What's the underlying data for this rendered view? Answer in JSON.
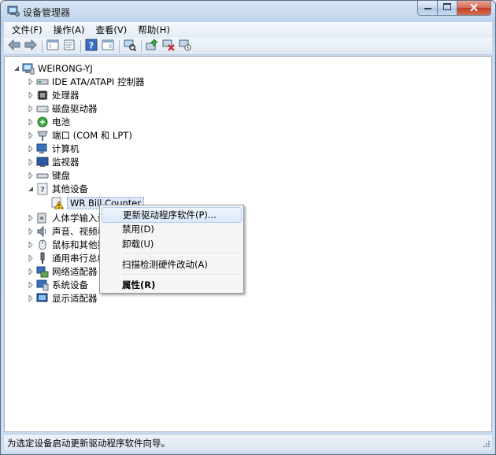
{
  "window": {
    "title": "设备管理器",
    "icons": {
      "app": "device-manager-icon",
      "minimize": "minimize-icon",
      "maximize": "maximize-icon",
      "close": "close-icon"
    }
  },
  "menubar": {
    "items": [
      "文件(F)",
      "操作(A)",
      "查看(V)",
      "帮助(H)"
    ]
  },
  "toolbar": {
    "icons": [
      "back-arrow-icon",
      "forward-arrow-icon",
      "properties-icon",
      "view-icon",
      "help-icon",
      "view-tab-icon",
      "scan-hardware-icon",
      "update-driver-icon",
      "uninstall-icon",
      "disable-icon"
    ]
  },
  "tree": {
    "root": "WEIRONG-YJ",
    "items": [
      {
        "label": "IDE ATA/ATAPI 控制器",
        "icon": "ide-controller-icon"
      },
      {
        "label": "处理器",
        "icon": "processor-icon"
      },
      {
        "label": "磁盘驱动器",
        "icon": "disk-drive-icon"
      },
      {
        "label": "电池",
        "icon": "battery-icon"
      },
      {
        "label": "端口 (COM 和 LPT)",
        "icon": "port-icon"
      },
      {
        "label": "计算机",
        "icon": "computer-icon"
      },
      {
        "label": "监视器",
        "icon": "monitor-icon"
      },
      {
        "label": "键盘",
        "icon": "keyboard-icon"
      },
      {
        "label": "其他设备",
        "icon": "other-devices-icon",
        "expanded": true
      },
      {
        "label": "WR Bill Counter",
        "icon": "warning-device-icon",
        "child": true,
        "selected": true
      },
      {
        "label": "人体学输入设",
        "icon": "hid-icon"
      },
      {
        "label": "声音、视频和",
        "icon": "sound-icon"
      },
      {
        "label": "鼠标和其他指",
        "icon": "mouse-icon"
      },
      {
        "label": "通用串行总线",
        "icon": "usb-icon"
      },
      {
        "label": "网络适配器",
        "icon": "network-adapter-icon"
      },
      {
        "label": "系统设备",
        "icon": "system-device-icon"
      },
      {
        "label": "显示适配器",
        "icon": "display-adapter-icon"
      }
    ]
  },
  "context_menu": {
    "items": [
      {
        "label": "更新驱动程序软件(P)...",
        "highlighted": true
      },
      {
        "label": "禁用(D)"
      },
      {
        "label": "卸载(U)"
      },
      {
        "label": "扫描检测硬件改动(A)"
      },
      {
        "label": "属性(R)",
        "bold": true
      }
    ]
  },
  "statusbar": {
    "text": "为选定设备启动更新驱动程序软件向导。"
  }
}
